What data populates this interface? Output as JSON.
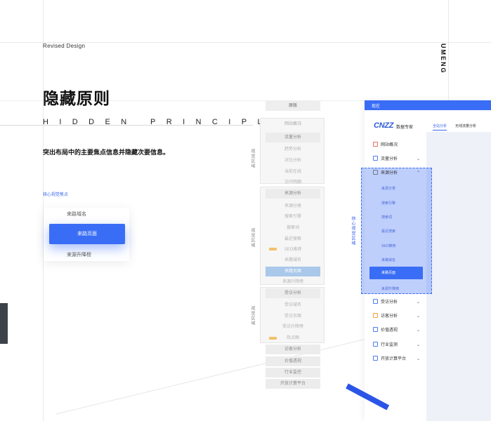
{
  "header": {
    "revised": "Revised Design",
    "brand_vertical": "UMENG",
    "title_cn": "隐藏原则",
    "title_en": "HIDDEN PRINCIPLES",
    "subtitle": "突出布局中的主要焦点信息并隐藏次要信息。"
  },
  "demo": {
    "core_label": "核心视觉焦点",
    "items": [
      "来路域名",
      "来路页面",
      "来源升降榜"
    ]
  },
  "wireframe": {
    "top_label": "原版",
    "side_labels": [
      "视觉区域",
      "视觉区域",
      "视觉区域"
    ],
    "rows": [
      {
        "label": "网站概况",
        "kind": "plain"
      },
      {
        "label": "流量分析",
        "kind": "head"
      },
      {
        "label": "趋势分析",
        "kind": "sub"
      },
      {
        "label": "对比分析",
        "kind": "sub"
      },
      {
        "label": "当前在线",
        "kind": "sub"
      },
      {
        "label": "访问明细",
        "kind": "sub"
      },
      {
        "label": "来源分析",
        "kind": "head"
      },
      {
        "label": "来源分类",
        "kind": "sub"
      },
      {
        "label": "搜索引擎",
        "kind": "sub"
      },
      {
        "label": "搜索词",
        "kind": "sub"
      },
      {
        "label": "最近搜索",
        "kind": "sub"
      },
      {
        "label": "SEO推荐",
        "kind": "sub"
      },
      {
        "label": "来路域名",
        "kind": "sub"
      },
      {
        "label": "来路页面",
        "kind": "hl"
      },
      {
        "label": "来源升降榜",
        "kind": "sub"
      },
      {
        "label": "受访分析",
        "kind": "head"
      },
      {
        "label": "受访域名",
        "kind": "sub"
      },
      {
        "label": "受访页面",
        "kind": "sub"
      },
      {
        "label": "受访升降榜",
        "kind": "sub"
      },
      {
        "label": "热点图",
        "kind": "sub"
      },
      {
        "label": "访客分析",
        "kind": "bottom"
      },
      {
        "label": "价值透视",
        "kind": "bottom"
      },
      {
        "label": "行业监控",
        "kind": "bottom"
      },
      {
        "label": "开放计算平台",
        "kind": "bottom"
      }
    ]
  },
  "panel": {
    "top_label": "现在",
    "core_side_label": "核心视觉区域",
    "logo": "CNZZ",
    "logo_sub": "数据专家",
    "tabs": [
      "全站分析",
      "无线流量分析"
    ],
    "nav": [
      {
        "label": "网站概况",
        "icon": "grid-icon",
        "color": "#e36f5b",
        "chev": ""
      },
      {
        "label": "流量分析",
        "icon": "chart-icon",
        "color": "#4c7cf0",
        "chev": "⌄"
      },
      {
        "label": "来源分析",
        "icon": "globe-icon",
        "color": "#6c7a8d",
        "chev": "⌃"
      },
      {
        "label": "受访分析",
        "icon": "refresh-icon",
        "color": "#4c7cf0",
        "chev": "⌄"
      },
      {
        "label": "访客分析",
        "icon": "user-icon",
        "color": "#f0a03a",
        "chev": "⌄"
      },
      {
        "label": "价值透视",
        "icon": "layers-icon",
        "color": "#4c7cf0",
        "chev": "⌄"
      },
      {
        "label": "行业监测",
        "icon": "monitor-icon",
        "color": "#4c7cf0",
        "chev": "⌄"
      },
      {
        "label": "开放计算平台",
        "icon": "send-icon",
        "color": "#4c7cf0",
        "chev": "⌄"
      }
    ],
    "sub": [
      "来源分类",
      "搜索引擎",
      "搜索词",
      "最近搜索",
      "SEO推荐",
      "来路域名",
      "来路页面",
      "来源升降榜"
    ]
  }
}
